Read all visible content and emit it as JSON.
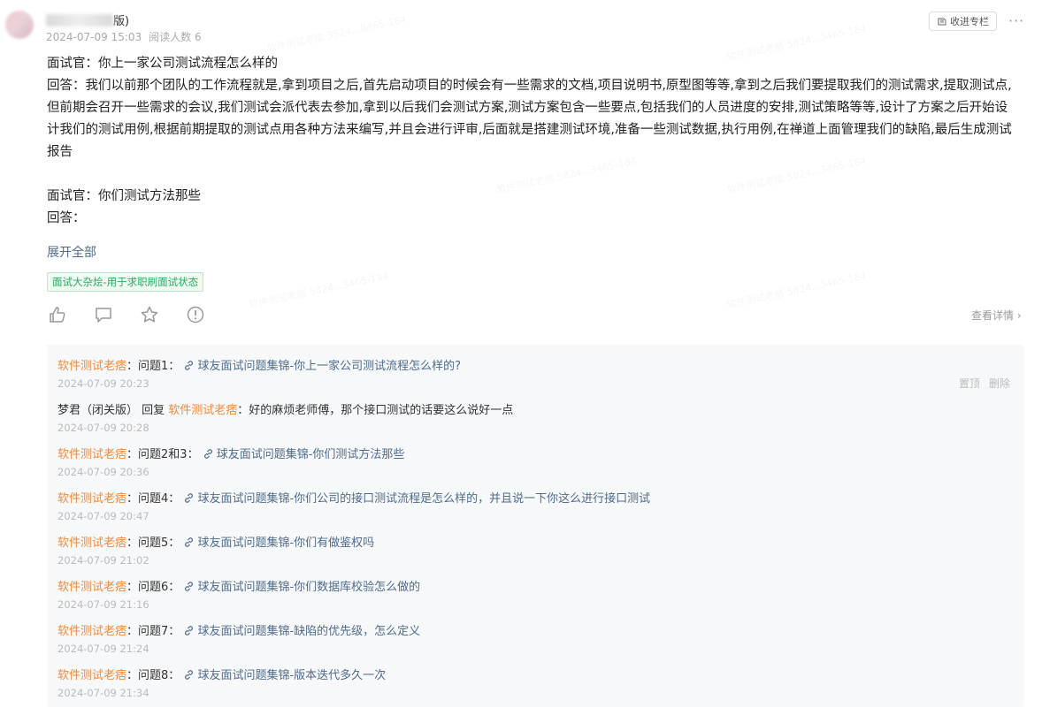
{
  "post": {
    "author_suffix": "版)",
    "date": "2024-07-09 15:03",
    "reads": "阅读人数 6",
    "collect_label": "收进专栏",
    "more_label": "···",
    "paragraphs": [
      "面试官：你上一家公司测试流程怎么样的",
      "回答：我们以前那个团队的工作流程就是,拿到项目之后,首先启动项目的时候会有一些需求的文档,项目说明书,原型图等等,拿到之后我们要提取我们的测试需求,提取测试点,但前期会召开一些需求的会议,我们测试会派代表去参加,拿到以后我们会测试方案,测试方案包含一些要点,包括我们的人员进度的安排,测试策略等等,设计了方案之后开始设计我们的测试用例,根据前期提取的测试点用各种方法来编写,并且会进行评审,后面就是搭建测试环境,准备一些测试数据,执行用例,在禅道上面管理我们的缺陷,最后生成测试报告",
      "",
      "面试官：你们测试方法那些",
      "回答："
    ],
    "expand_label": "展开全部",
    "tag_label": "面试大杂烩-用于求职刷面试状态",
    "view_detail_label": "查看详情 ›",
    "icons": [
      "like-icon",
      "comment-icon",
      "star-icon",
      "report-icon"
    ]
  },
  "comments": {
    "ops": {
      "pin": "置顶",
      "delete": "删除"
    },
    "items": [
      {
        "name": "软件测试老痞",
        "sep": "：",
        "prefix": "问题1： ",
        "link": "球友面试问题集锦-你上一家公司测试流程怎么样的?",
        "date": "2024-07-09 20:23"
      },
      {
        "name": "梦君（闭关版）",
        "reply_word": " 回复 ",
        "reply_to": "软件测试老痞",
        "text": "：好的麻烦老师傅，那个接口测试的话要这么说好一点",
        "date": "2024-07-09 20:28"
      },
      {
        "name": "软件测试老痞",
        "sep": "：",
        "prefix": "问题2和3： ",
        "link": "球友面试问题集锦-你们测试方法那些",
        "date": "2024-07-09 20:36"
      },
      {
        "name": "软件测试老痞",
        "sep": "：",
        "prefix": "问题4： ",
        "link": "球友面试问题集锦-你们公司的接口测试流程是怎么样的，并且说一下你这么进行接口测试",
        "date": "2024-07-09 20:47"
      },
      {
        "name": "软件测试老痞",
        "sep": "：",
        "prefix": "问题5： ",
        "link": "球友面试问题集锦-你们有做鉴权吗",
        "date": "2024-07-09 21:02"
      },
      {
        "name": "软件测试老痞",
        "sep": "：",
        "prefix": "问题6： ",
        "link": "球友面试问题集锦-你们数据库校验怎么做的",
        "date": "2024-07-09 21:16"
      },
      {
        "name": "软件测试老痞",
        "sep": "：",
        "prefix": "问题7： ",
        "link": "球友面试问题集锦-缺陷的优先级，怎么定义",
        "date": "2024-07-09 21:24"
      },
      {
        "name": "软件测试老痞",
        "sep": "：",
        "prefix": "问题8： ",
        "link": "球友面试问题集锦-版本迭代多久一次",
        "date": "2024-07-09 21:34"
      }
    ]
  }
}
